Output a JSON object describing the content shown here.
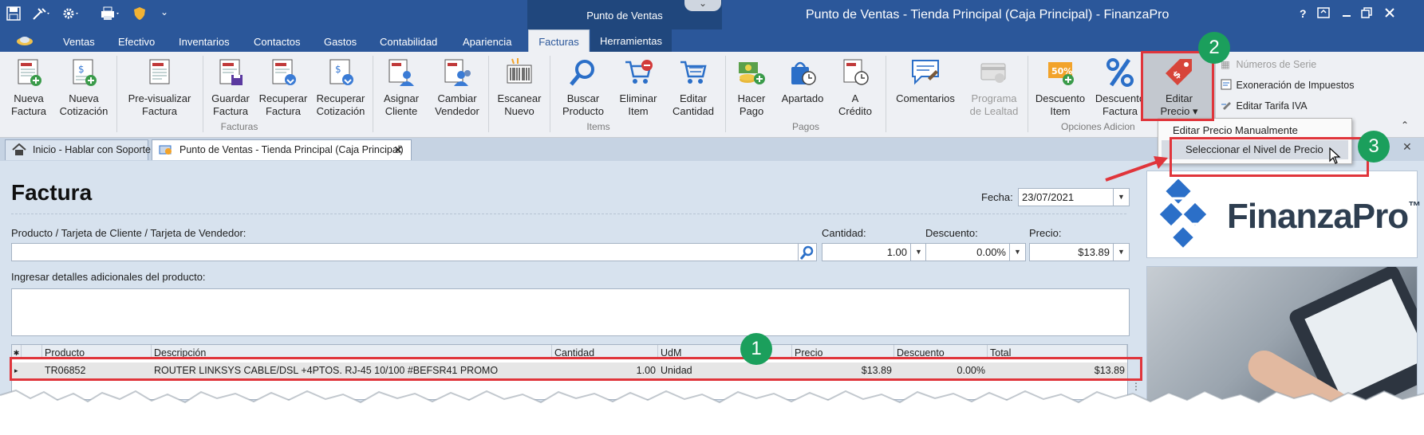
{
  "titlebar": {
    "context_group": "Punto de Ventas",
    "window_title": "Punto de Ventas - Tienda Principal (Caja Principal) - FinanzaPro",
    "help": "?"
  },
  "tabs": {
    "ventas": "Ventas",
    "efectivo": "Efectivo",
    "inventarios": "Inventarios",
    "contactos": "Contactos",
    "gastos": "Gastos",
    "contabilidad": "Contabilidad",
    "apariencia": "Apariencia",
    "facturas": "Facturas",
    "herramientas": "Herramientas"
  },
  "ribbon": {
    "buttons": [
      {
        "l1": "Nueva",
        "l2": "Factura"
      },
      {
        "l1": "Nueva",
        "l2": "Cotización"
      },
      {
        "l1": "Pre-visualizar",
        "l2": "Factura"
      },
      {
        "l1": "Guardar",
        "l2": "Factura"
      },
      {
        "l1": "Recuperar",
        "l2": "Factura"
      },
      {
        "l1": "Recuperar",
        "l2": "Cotización"
      },
      {
        "l1": "Asignar",
        "l2": "Cliente"
      },
      {
        "l1": "Cambiar",
        "l2": "Vendedor"
      },
      {
        "l1": "Escanear",
        "l2": "Nuevo"
      },
      {
        "l1": "Buscar",
        "l2": "Producto"
      },
      {
        "l1": "Eliminar",
        "l2": "Item"
      },
      {
        "l1": "Editar",
        "l2": "Cantidad"
      },
      {
        "l1": "Hacer",
        "l2": "Pago"
      },
      {
        "l1": "Apartado",
        "l2": ""
      },
      {
        "l1": "A",
        "l2": "Crédito"
      },
      {
        "l1": "Comentarios",
        "l2": ""
      },
      {
        "l1": "Programa",
        "l2": "de Lealtad"
      },
      {
        "l1": "Descuento",
        "l2": "Item"
      },
      {
        "l1": "Descuento",
        "l2": "Factura"
      },
      {
        "l1": "Editar",
        "l2": "Precio ▾"
      }
    ],
    "groups": {
      "facturas": "Facturas",
      "items": "Items",
      "pagos": "Pagos",
      "opciones": "Opciones Adicion"
    },
    "small_buttons": {
      "numeros_serie": "Números de Serie",
      "exoneracion": "Exoneración de Impuestos",
      "tarifa_iva": "Editar Tarifa IVA"
    },
    "discount_icon_text": "50%"
  },
  "dropdown": {
    "item1": "Editar Precio Manualmente",
    "item2": "Seleccionar el Nivel de Precio"
  },
  "doctabs": {
    "home": "Inicio - Hablar con Soporte",
    "pos": "Punto de Ventas - Tienda Principal (Caja Principal)"
  },
  "form": {
    "heading": "Factura",
    "fecha_label": "Fecha:",
    "fecha_value": "23/07/2021",
    "product_label": "Producto / Tarjeta de Cliente / Tarjeta de Vendedor:",
    "cantidad_label": "Cantidad:",
    "cantidad_value": "1.00",
    "descuento_label": "Descuento:",
    "descuento_value": "0.00%",
    "precio_label": "Precio:",
    "precio_value": "$13.89",
    "details_label": "Ingresar detalles adicionales del producto:"
  },
  "grid": {
    "headers": [
      "Producto",
      "Descripción",
      "Cantidad",
      "UdM",
      "Precio",
      "Descuento",
      "Total"
    ],
    "row": [
      "TR06852",
      "ROUTER LINKSYS CABLE/DSL +4PTOS. RJ-45 10/100 #BEFSR41 PROMO",
      "1.00",
      "Unidad",
      "$13.89",
      "0.00%",
      "$13.89"
    ]
  },
  "logo": {
    "text": "FinanzaPro",
    "tm": "™"
  },
  "annotations": {
    "b1": "1",
    "b2": "2",
    "b3": "3"
  },
  "colors": {
    "accent": "#2b579a",
    "annotation_red": "#e0353b",
    "badge_green": "#1b9f5c"
  }
}
